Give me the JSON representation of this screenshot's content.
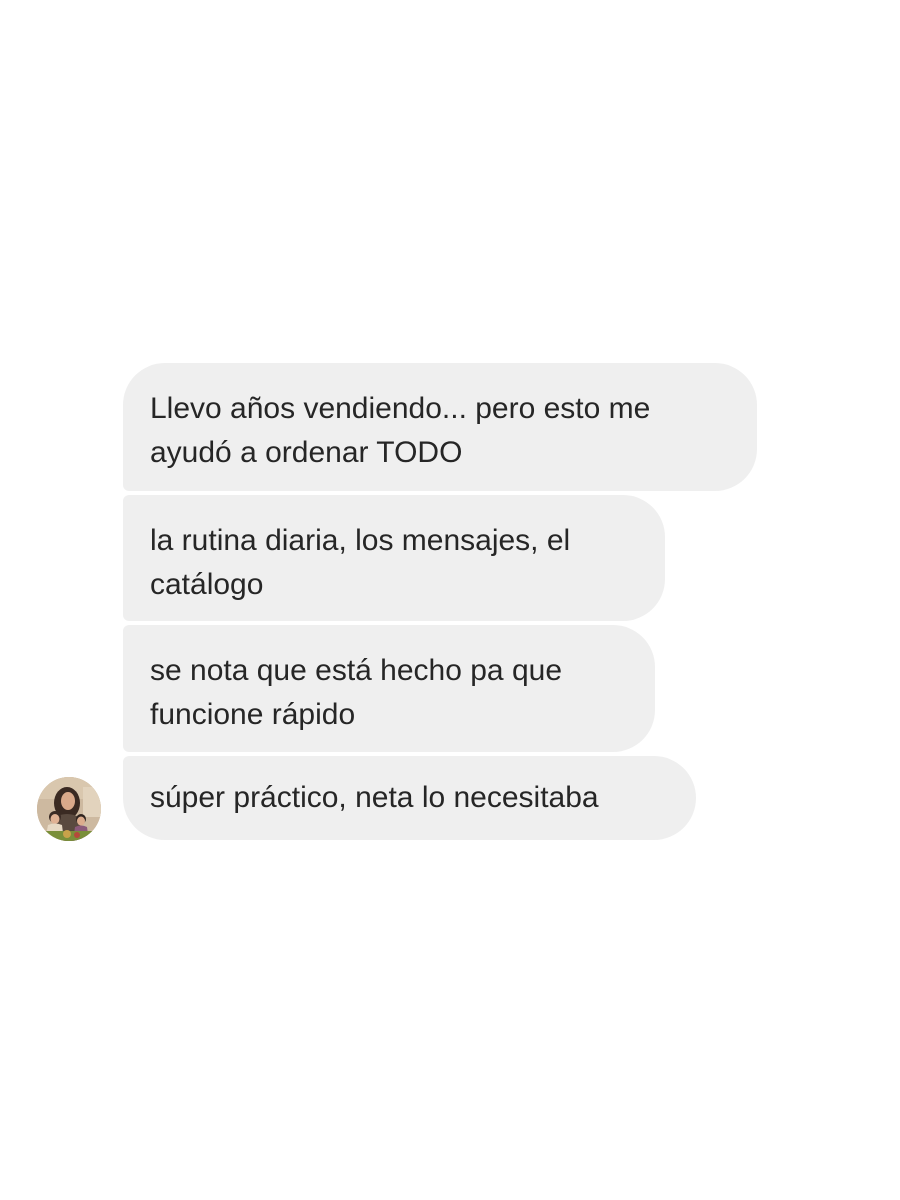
{
  "conversation": {
    "messages": [
      {
        "lines": [
          "Llevo años vendiendo... pero esto me",
          "ayudó a ordenar TODO"
        ]
      },
      {
        "lines": [
          "la rutina diaria, los mensajes, el",
          "catálogo"
        ]
      },
      {
        "lines": [
          "se nota que está hecho pa que",
          "funcione rápido"
        ]
      },
      {
        "lines": [
          "súper práctico, neta lo necesitaba"
        ]
      }
    ],
    "avatar": {
      "icon": "contact-avatar-photo"
    }
  },
  "colors": {
    "background": "#ffffff",
    "bubble": "#efefef",
    "text": "#262626"
  }
}
